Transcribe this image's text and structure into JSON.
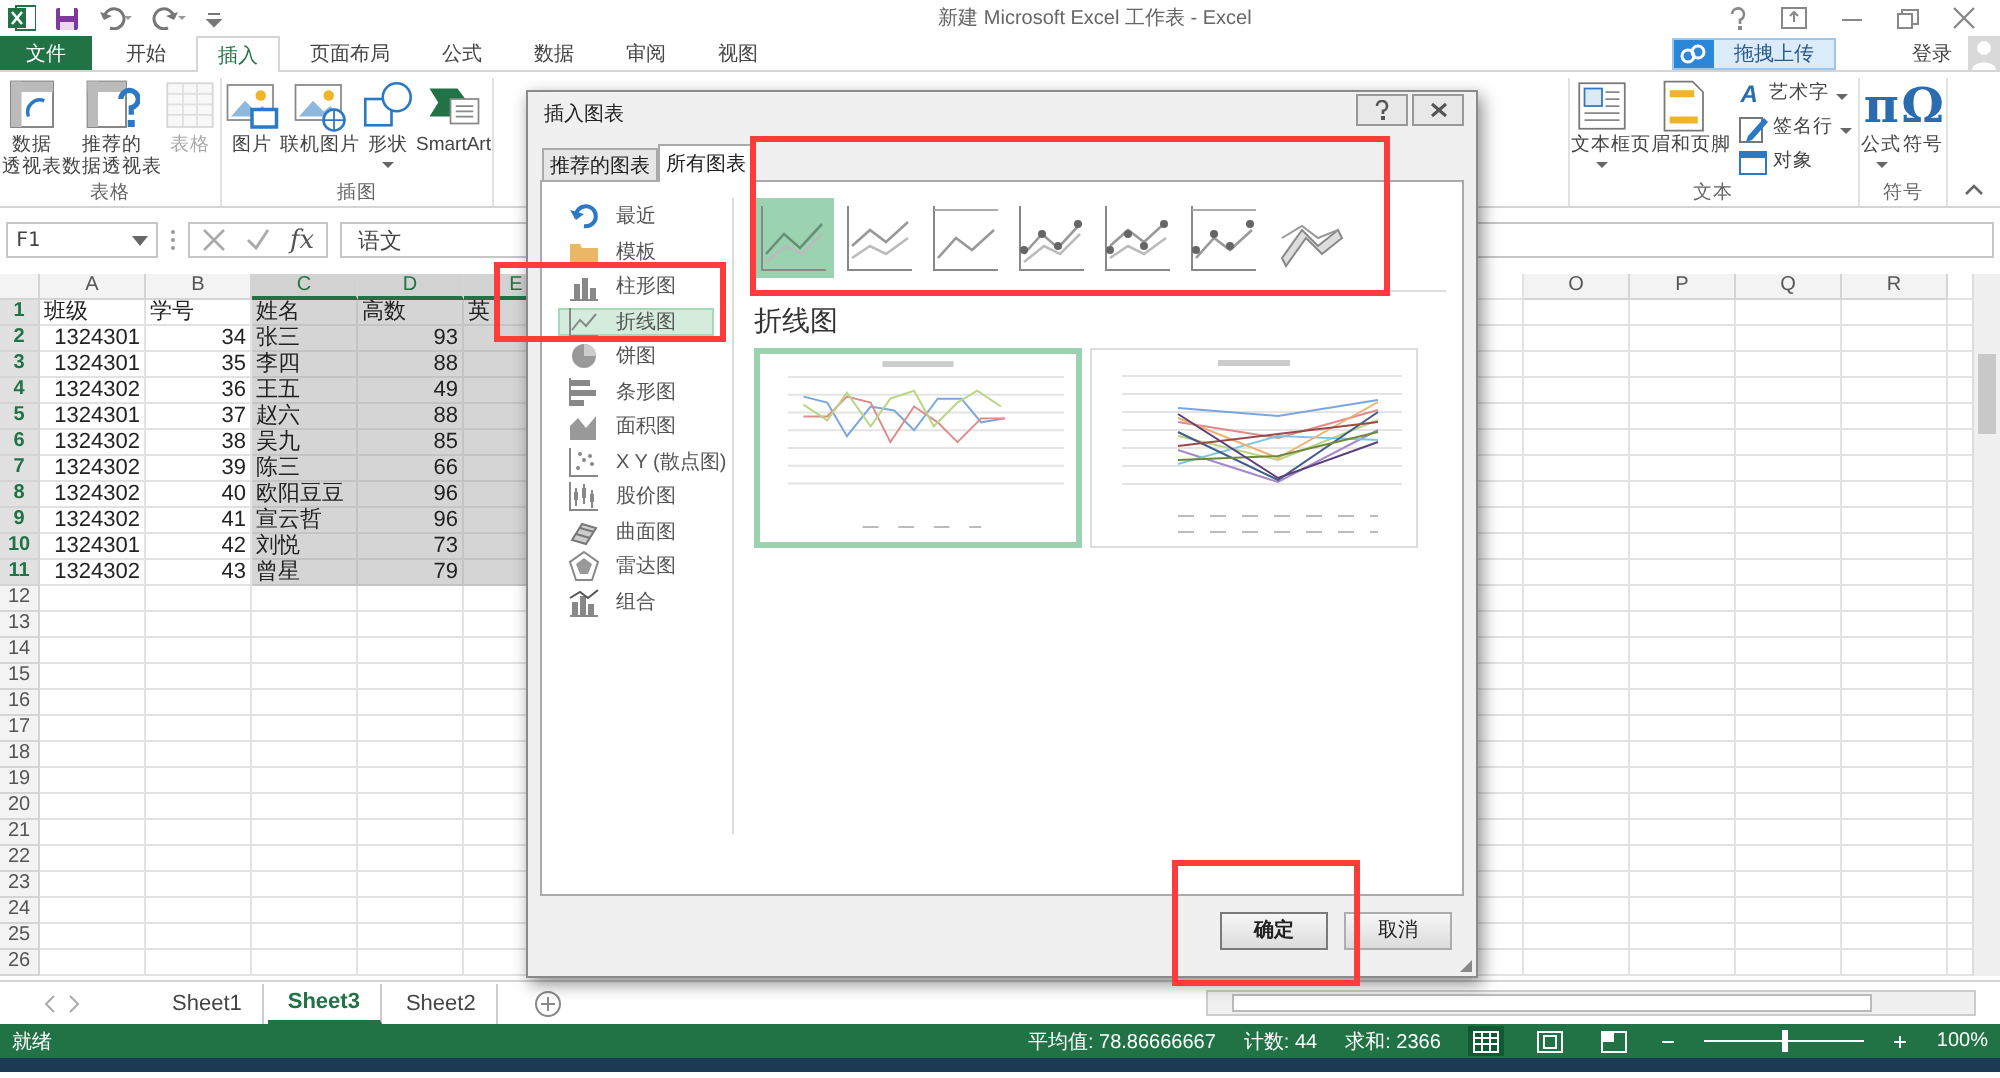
{
  "window": {
    "title": "新建 Microsoft Excel 工作表 - Excel"
  },
  "ribbon_tabs": [
    {
      "label": "文件",
      "kind": "file",
      "selected": false
    },
    {
      "label": "开始",
      "kind": "tab",
      "selected": false
    },
    {
      "label": "插入",
      "kind": "tab",
      "selected": true
    },
    {
      "label": "页面布局",
      "kind": "tab",
      "selected": false
    },
    {
      "label": "公式",
      "kind": "tab",
      "selected": false
    },
    {
      "label": "数据",
      "kind": "tab",
      "selected": false
    },
    {
      "label": "审阅",
      "kind": "tab",
      "selected": false
    },
    {
      "label": "视图",
      "kind": "tab",
      "selected": false
    }
  ],
  "upload_button": {
    "label": "拖拽上传"
  },
  "account": {
    "label": "登录"
  },
  "ribbon_groups": [
    {
      "label": "表格",
      "items": [
        {
          "kind": "large",
          "lines": [
            "数据",
            "透视表"
          ],
          "dropdown": false,
          "disabled": false
        },
        {
          "kind": "large",
          "lines": [
            "推荐的",
            "数据透视表"
          ],
          "dropdown": false,
          "disabled": false
        },
        {
          "kind": "large",
          "lines": [
            "表格"
          ],
          "dropdown": false,
          "disabled": true
        }
      ]
    },
    {
      "label": "插图",
      "items": [
        {
          "kind": "large",
          "lines": [
            "图片"
          ],
          "dropdown": false,
          "disabled": false
        },
        {
          "kind": "large",
          "lines": [
            "联机图片"
          ],
          "dropdown": false,
          "disabled": false
        },
        {
          "kind": "large",
          "lines": [
            "形状"
          ],
          "dropdown": true,
          "disabled": false
        },
        {
          "kind": "large",
          "lines": [
            "SmartArt"
          ],
          "dropdown": false,
          "disabled": false
        }
      ]
    },
    {
      "label": "文本",
      "items": [
        {
          "kind": "large",
          "lines": [
            "文本框"
          ],
          "dropdown": true,
          "disabled": false
        },
        {
          "kind": "large",
          "lines": [
            "页眉和页脚"
          ],
          "dropdown": false,
          "disabled": false
        },
        {
          "kind": "stack",
          "items": [
            {
              "kind": "small",
              "glyph": "A",
              "lines": [
                "艺术字"
              ],
              "dropdown": true,
              "disabled": false
            },
            {
              "kind": "small",
              "lines": [
                "签名行"
              ],
              "dropdown": true,
              "disabled": false
            },
            {
              "kind": "small",
              "lines": [
                "对象"
              ],
              "dropdown": false,
              "disabled": false
            }
          ]
        }
      ]
    },
    {
      "label": "符号",
      "items": [
        {
          "kind": "large",
          "glyph": "π",
          "lines": [
            "公式"
          ],
          "dropdown": true,
          "disabled": false
        },
        {
          "kind": "large",
          "glyph": "Ω",
          "lines": [
            "符号"
          ],
          "dropdown": false,
          "disabled": false
        }
      ]
    }
  ],
  "name_box": {
    "value": "F1"
  },
  "formula_bar": {
    "fx": "fx",
    "value": "语文"
  },
  "sheet": {
    "columns": [
      {
        "label": "A",
        "selected": false
      },
      {
        "label": "B",
        "selected": false
      },
      {
        "label": "C",
        "selected": true
      },
      {
        "label": "D",
        "selected": true
      },
      {
        "label": "E",
        "selected": true
      },
      {
        "label": "O",
        "selected": false
      },
      {
        "label": "P",
        "selected": false
      },
      {
        "label": "Q",
        "selected": false
      },
      {
        "label": "R",
        "selected": false
      }
    ],
    "rows": [
      {
        "number": "1",
        "selected": true,
        "cells": [
          "班级",
          "学号",
          "姓名",
          "高数",
          "英"
        ]
      },
      {
        "number": "2",
        "selected": true,
        "cells": [
          "1324301",
          "34",
          "张三",
          "93"
        ]
      },
      {
        "number": "3",
        "selected": true,
        "cells": [
          "1324301",
          "35",
          "李四",
          "88"
        ]
      },
      {
        "number": "4",
        "selected": true,
        "cells": [
          "1324302",
          "36",
          "王五",
          "49"
        ]
      },
      {
        "number": "5",
        "selected": true,
        "cells": [
          "1324301",
          "37",
          "赵六",
          "88"
        ]
      },
      {
        "number": "6",
        "selected": true,
        "cells": [
          "1324302",
          "38",
          "吴九",
          "85"
        ]
      },
      {
        "number": "7",
        "selected": true,
        "cells": [
          "1324302",
          "39",
          "陈三",
          "66"
        ]
      },
      {
        "number": "8",
        "selected": true,
        "cells": [
          "1324302",
          "40",
          "欧阳豆豆",
          "96"
        ]
      },
      {
        "number": "9",
        "selected": true,
        "cells": [
          "1324302",
          "41",
          "宣云哲",
          "96"
        ]
      },
      {
        "number": "10",
        "selected": true,
        "cells": [
          "1324301",
          "42",
          "刘悦",
          "73"
        ]
      },
      {
        "number": "11",
        "selected": true,
        "cells": [
          "1324302",
          "43",
          "曾星",
          "79"
        ]
      },
      {
        "number": "12",
        "selected": false
      },
      {
        "number": "13",
        "selected": false
      },
      {
        "number": "14",
        "selected": false
      },
      {
        "number": "15",
        "selected": false
      },
      {
        "number": "16",
        "selected": false
      },
      {
        "number": "17",
        "selected": false
      },
      {
        "number": "18",
        "selected": false
      },
      {
        "number": "19",
        "selected": false
      },
      {
        "number": "20",
        "selected": false
      },
      {
        "number": "21",
        "selected": false
      },
      {
        "number": "22",
        "selected": false
      },
      {
        "number": "23",
        "selected": false
      },
      {
        "number": "24",
        "selected": false
      },
      {
        "number": "25",
        "selected": false
      },
      {
        "number": "26",
        "selected": false
      }
    ]
  },
  "sheet_tabs": [
    {
      "label": "Sheet1",
      "selected": false
    },
    {
      "label": "Sheet3",
      "selected": true
    },
    {
      "label": "Sheet2",
      "selected": false
    }
  ],
  "status_bar": {
    "mode": "就绪",
    "average": "平均值: 78.86666667",
    "count": "计数: 44",
    "sum": "求和: 2366",
    "views": [
      {
        "kind": "normal",
        "selected": true
      },
      {
        "kind": "layout",
        "selected": false
      },
      {
        "kind": "pagebreak",
        "selected": false
      }
    ],
    "zoom": {
      "level": 0.5,
      "reading": "100%"
    }
  },
  "dialog": {
    "title": "插入图表",
    "tabs": [
      {
        "label": "推荐的图表",
        "selected": false
      },
      {
        "label": "所有图表",
        "selected": true
      }
    ],
    "categories": [
      {
        "label": "最近",
        "kind": "recent",
        "selected": false
      },
      {
        "label": "模板",
        "kind": "template",
        "selected": false
      },
      {
        "label": "柱形图",
        "kind": "column",
        "selected": false
      },
      {
        "label": "折线图",
        "kind": "line",
        "selected": true
      },
      {
        "label": "饼图",
        "kind": "pie",
        "selected": false
      },
      {
        "label": "条形图",
        "kind": "bar",
        "selected": false
      },
      {
        "label": "面积图",
        "kind": "area",
        "selected": false
      },
      {
        "label": "X Y (散点图)",
        "kind": "scatter",
        "selected": false
      },
      {
        "label": "股价图",
        "kind": "stock",
        "selected": false
      },
      {
        "label": "曲面图",
        "kind": "surface",
        "selected": false
      },
      {
        "label": "雷达图",
        "kind": "radar",
        "selected": false
      },
      {
        "label": "组合",
        "kind": "combo",
        "selected": false
      }
    ],
    "subtypes": [
      {
        "kind": "line",
        "selected": true
      },
      {
        "kind": "stacked",
        "selected": false
      },
      {
        "kind": "percent",
        "selected": false
      },
      {
        "kind": "line_markers",
        "selected": false
      },
      {
        "kind": "stacked_markers",
        "selected": false
      },
      {
        "kind": "percent_markers",
        "selected": false
      },
      {
        "kind": "line3d",
        "selected": false
      }
    ],
    "heading": "折线图",
    "previews": [
      {
        "kind": "few_series",
        "selected": true
      },
      {
        "kind": "many_series",
        "selected": false
      }
    ],
    "buttons": [
      {
        "label": "确定",
        "kind": "default"
      },
      {
        "label": "取消",
        "kind": "normal"
      }
    ]
  }
}
